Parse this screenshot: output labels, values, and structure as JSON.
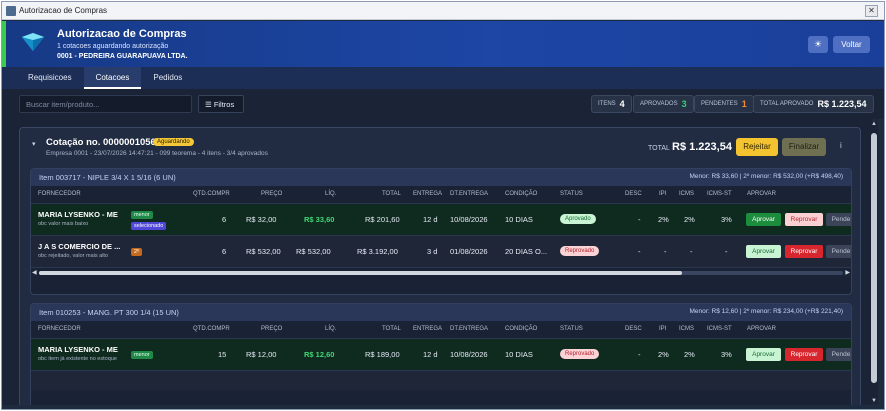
{
  "window": {
    "title": "Autorizacao de Compras",
    "close": "✕"
  },
  "header": {
    "title": "Autorizacao de Compras",
    "subtitle": "1 cotacoes aguardando autorização",
    "company": "0001 - PEDREIRA GUARAPUAVA LTDA.",
    "theme_icon": "☀",
    "back_label": "Voltar"
  },
  "tabs": [
    {
      "label": "Requisicoes"
    },
    {
      "label": "Cotacoes"
    },
    {
      "label": "Pedidos"
    }
  ],
  "toolbar": {
    "search_placeholder": "Buscar item/produto...",
    "filter_label": "Filtros",
    "stats": [
      {
        "label": "Itens",
        "value": "4",
        "color": "#ffffff"
      },
      {
        "label": "Aprovados",
        "value": "3",
        "color": "#36d06b"
      },
      {
        "label": "Pendentes",
        "value": "1",
        "color": "#f08a3c"
      },
      {
        "label": "Total aprovado",
        "value": "R$ 1.223,54",
        "color": "#ffffff"
      }
    ]
  },
  "quote": {
    "title": "Cotação no. 0000001056",
    "status": "Aguardando",
    "subtitle": "Empresa 0001 - 23/07/2026 14:47:21 - 099 teorema - 4 itens - 3/4 aprovados",
    "total_label": "TOTAL",
    "total": "R$ 1.223,54",
    "reject_label": "Rejeitar",
    "finish_label": "Finalizar",
    "info_icon": "i"
  },
  "columns": [
    "Fornecedor",
    "Qtd.compr",
    "Preço",
    "Líq.",
    "Total",
    "Entrega",
    "Dt.entrega",
    "Condição",
    "Status",
    "Desc",
    "IPI",
    "ICMS",
    "ICMS-ST",
    "Aprovar"
  ],
  "items": [
    {
      "name": "Item 003717 - NIPLE 3/4 X 1 5/16 (6 UN)",
      "summary": "Menor: R$ 33,60 | 2º menor: R$ 532,00 (+R$ 498,40)",
      "rows": [
        {
          "supplier": "MARIA LYSENKO - ME",
          "obs": "obc valor mais baixo",
          "tags": [
            "menor",
            "selecionado"
          ],
          "qtd": "6",
          "preco": "R$ 32,00",
          "liq": "R$ 33,60",
          "total": "R$ 201,60",
          "entrega": "12 d",
          "dt": "10/08/2026",
          "cond": "10 DIAS",
          "status": "Aprovado",
          "desc": "-",
          "ipi": "2%",
          "icms": "2%",
          "icmsst": "3%",
          "kind": "good"
        },
        {
          "supplier": "J A S COMERCIO DE ...",
          "obs": "obc rejeitado, valor mais alto",
          "tags": [
            "2º"
          ],
          "qtd": "6",
          "preco": "R$ 532,00",
          "liq": "R$ 532,00",
          "total": "R$ 3.192,00",
          "entrega": "3 d",
          "dt": "01/08/2026",
          "cond": "20 DIAS O...",
          "status": "Reprovado",
          "desc": "-",
          "ipi": "-",
          "icms": "-",
          "icmsst": "-",
          "kind": "bad"
        }
      ]
    },
    {
      "name": "Item 010253 - MANG. PT 300 1/4 (15 UN)",
      "summary": "Menor: R$ 12,60 | 2º menor: R$ 234,00 (+R$ 221,40)",
      "rows": [
        {
          "supplier": "MARIA LYSENKO - ME",
          "obs": "obc item já existente no estoque",
          "tags": [
            "menor"
          ],
          "qtd": "15",
          "preco": "R$ 12,00",
          "liq": "R$ 12,60",
          "total": "R$ 189,00",
          "entrega": "12 d",
          "dt": "10/08/2026",
          "cond": "10 DIAS",
          "status": "Reprovado",
          "desc": "-",
          "ipi": "2%",
          "icms": "2%",
          "icmsst": "3%",
          "kind": "good"
        }
      ]
    }
  ],
  "actions": {
    "approve": "Aprovar",
    "reject": "Reprovar",
    "pending": "Pende"
  },
  "scroll_arrows": {
    "up": "▲",
    "down": "▼",
    "left": "◀",
    "right": "▶"
  }
}
